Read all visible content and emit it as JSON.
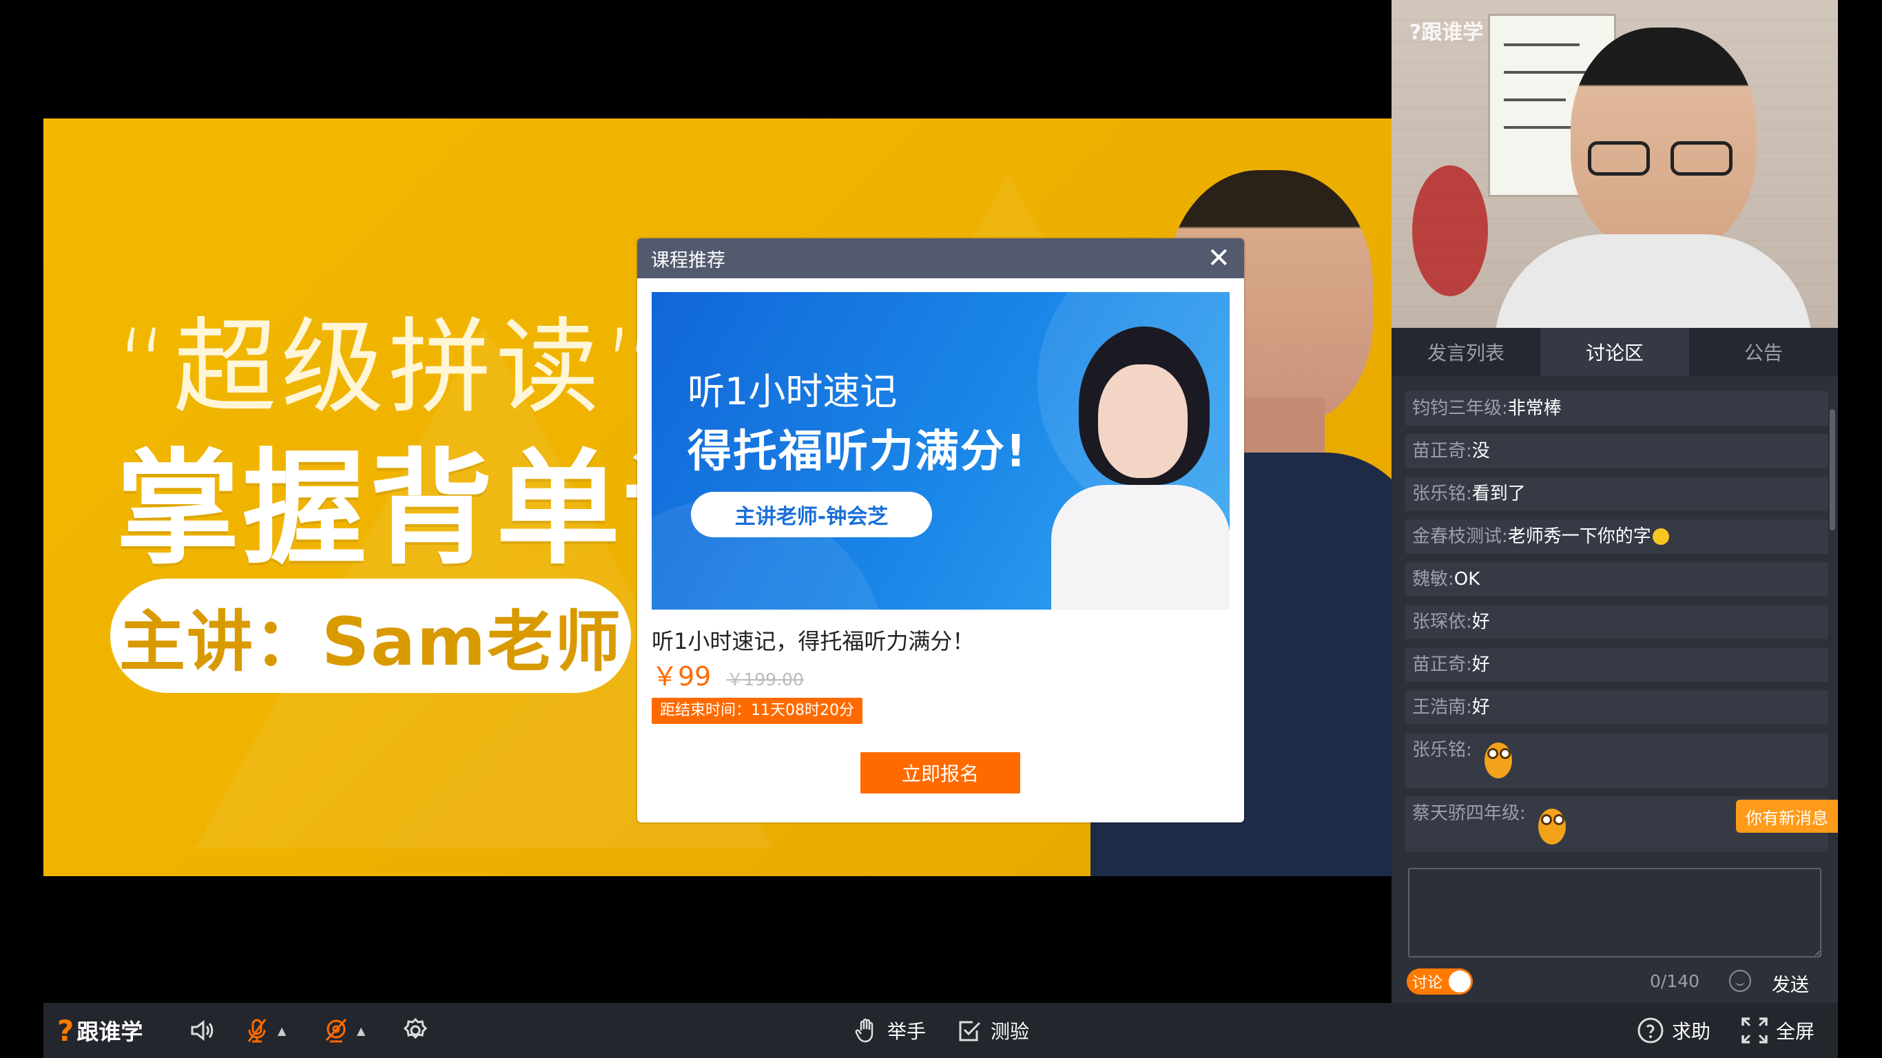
{
  "slide": {
    "quote_line": "“超级拼读”",
    "headline": "掌握背单词",
    "pill_text": "主讲：Sam老师"
  },
  "popup": {
    "title": "课程推荐",
    "close_icon": "close-icon",
    "banner": {
      "line1": "听1小时速记",
      "line2": "得托福听力满分!",
      "pill": "主讲老师-钟会芝"
    },
    "course_name": "听1小时速记，得托福听力满分！",
    "price_now": "￥99",
    "price_old": "￥199.00",
    "countdown": "距结束时间：11天08时20分",
    "signup_label": "立即报名"
  },
  "camera": {
    "logo": "?跟谁学"
  },
  "tabs": [
    {
      "label": "发言列表",
      "active": false
    },
    {
      "label": "讨论区",
      "active": true
    },
    {
      "label": "公告",
      "active": false
    }
  ],
  "messages": [
    {
      "user": "钧钧三年级:",
      "text": "非常棒"
    },
    {
      "user": "苗正奇:",
      "text": "没"
    },
    {
      "user": "张乐铭:",
      "text": "看到了"
    },
    {
      "user": "金春枝测试:",
      "text": "老师秀一下你的字"
    },
    {
      "user": "魏敏:",
      "text": "OK"
    },
    {
      "user": "张琛依:",
      "text": "好"
    },
    {
      "user": "苗正奇:",
      "text": "好"
    },
    {
      "user": "王浩南:",
      "text": "好"
    },
    {
      "user": "张乐铭:",
      "sticker": "owl-sticker"
    },
    {
      "user": "蔡天骄四年级:",
      "sticker": "owl-sticker"
    }
  ],
  "new_message_badge": "你有新消息",
  "composer": {
    "input_value": "",
    "toggle_label": "讨论",
    "counter": "0/140",
    "send_label": "发送"
  },
  "bottombar": {
    "logo_text": "跟谁学",
    "raise_hand": "举手",
    "quiz": "测验",
    "help": "求助",
    "fullscreen": "全屏"
  },
  "colors": {
    "accent": "#ff6a00",
    "slide_bg": "#f0b400",
    "panel_bg": "#2c3038",
    "header_bg": "#535a6e"
  }
}
